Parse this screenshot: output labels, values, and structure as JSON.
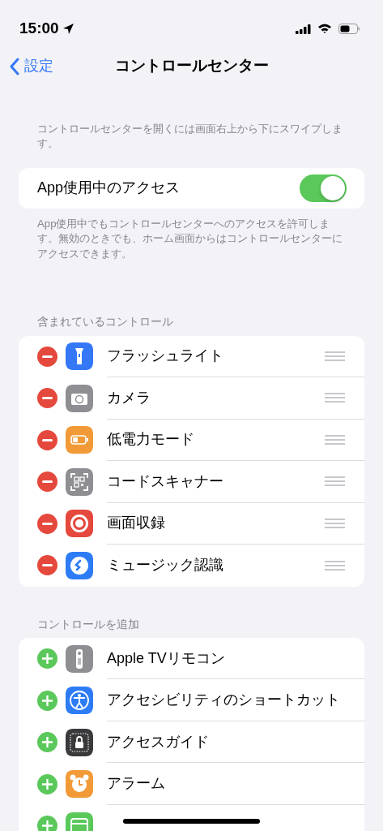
{
  "status_bar": {
    "time": "15:00"
  },
  "nav": {
    "back": "設定",
    "title": "コントロールセンター"
  },
  "intro": "コントロールセンターを開くには画面右上から下にスワイプします。",
  "access": {
    "label": "App使用中のアクセス",
    "on": true,
    "note": "App使用中でもコントロールセンターへのアクセスを許可します。無効のときでも、ホーム画面からはコントロールセンターにアクセスできます。"
  },
  "sections": [
    {
      "header": "含まれているコントロール",
      "kind": "included",
      "items": [
        {
          "label": "フラッシュライト",
          "color": "#3478f6"
        },
        {
          "label": "カメラ",
          "color": "#8e8e93"
        },
        {
          "label": "低電力モード",
          "color": "#f19a37"
        },
        {
          "label": "コードスキャナー",
          "color": "#8e8e93"
        },
        {
          "label": "画面収録",
          "color": "#e5483c"
        },
        {
          "label": "ミュージック認識",
          "color": "#2d7cf6"
        }
      ]
    },
    {
      "header": "コントロールを追加",
      "kind": "more",
      "items": [
        {
          "label": "Apple TVリモコン",
          "color": "#8e8e93"
        },
        {
          "label": "アクセシビリティのショートカット",
          "color": "#2d7cf6"
        },
        {
          "label": "アクセスガイド",
          "color": "#3a3a3c"
        },
        {
          "label": "アラーム",
          "color": "#f19a37"
        },
        {
          "color": "#5ac85a"
        }
      ]
    }
  ]
}
